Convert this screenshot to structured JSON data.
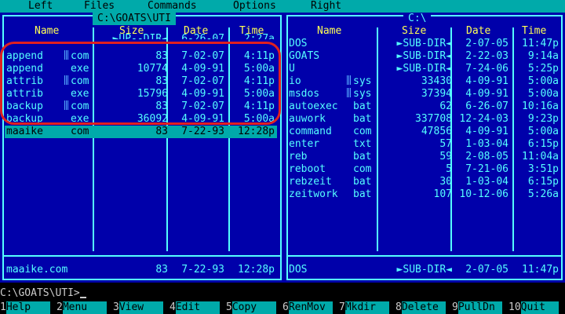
{
  "menu": [
    "Left",
    "Files",
    "Commands",
    "Options",
    "Right"
  ],
  "columns": {
    "name": "Name",
    "size": "Size",
    "date": "Date",
    "time": "Time"
  },
  "left_panel": {
    "title": "C:\\GOATS\\UTI",
    "top_partial": {
      "size": "►UP--DIR◄",
      "date": "6-26-07",
      "time": "2:27a"
    },
    "files": [
      {
        "name": "append",
        "ext": "com",
        "size": "83",
        "date": "7-02-07",
        "time": "4:11p",
        "marked": true
      },
      {
        "name": "append",
        "ext": "exe",
        "size": "10774",
        "date": "4-09-91",
        "time": "5:00a",
        "marked": false
      },
      {
        "name": "attrib",
        "ext": "com",
        "size": "83",
        "date": "7-02-07",
        "time": "4:11p",
        "marked": true
      },
      {
        "name": "attrib",
        "ext": "exe",
        "size": "15796",
        "date": "4-09-91",
        "time": "5:00a",
        "marked": false
      },
      {
        "name": "backup",
        "ext": "com",
        "size": "83",
        "date": "7-02-07",
        "time": "4:11p",
        "marked": true
      },
      {
        "name": "backup",
        "ext": "exe",
        "size": "36092",
        "date": "4-09-91",
        "time": "5:00a",
        "marked": false
      }
    ],
    "cursor_row": {
      "name": "maaike",
      "ext": "com",
      "size": "83",
      "date": "7-22-93",
      "time": "12:28p"
    },
    "status": {
      "name": "maaike.com",
      "size": "83",
      "date": "7-22-93",
      "time": "12:28p"
    }
  },
  "right_panel": {
    "title": "C:\\",
    "files": [
      {
        "name": "DOS",
        "ext": "",
        "size": "►SUB-DIR◄",
        "date": "2-07-05",
        "time": "11:47p",
        "marked": false
      },
      {
        "name": "GOATS",
        "ext": "",
        "size": "►SUB-DIR◄",
        "date": "2-22-03",
        "time": "9:14a",
        "marked": false
      },
      {
        "name": "U",
        "ext": "",
        "size": "►SUB-DIR◄",
        "date": "7-24-06",
        "time": "5:25p",
        "marked": false
      },
      {
        "name": "io",
        "ext": "sys",
        "size": "33430",
        "date": "4-09-91",
        "time": "5:00a",
        "marked": true
      },
      {
        "name": "msdos",
        "ext": "sys",
        "size": "37394",
        "date": "4-09-91",
        "time": "5:00a",
        "marked": true
      },
      {
        "name": "autoexec",
        "ext": "bat",
        "size": "62",
        "date": "6-26-07",
        "time": "10:16a",
        "marked": false
      },
      {
        "name": "auwork",
        "ext": "bat",
        "size": "337708",
        "date": "12-24-03",
        "time": "9:23p",
        "marked": false
      },
      {
        "name": "command",
        "ext": "com",
        "size": "47856",
        "date": "4-09-91",
        "time": "5:00a",
        "marked": false
      },
      {
        "name": "enter",
        "ext": "txt",
        "size": "57",
        "date": "1-03-04",
        "time": "6:15p",
        "marked": false
      },
      {
        "name": "reb",
        "ext": "bat",
        "size": "59",
        "date": "2-08-05",
        "time": "11:04a",
        "marked": false
      },
      {
        "name": "reboot",
        "ext": "com",
        "size": "5",
        "date": "7-21-06",
        "time": "3:51p",
        "marked": false
      },
      {
        "name": "rebzeit",
        "ext": "bat",
        "size": "30",
        "date": "1-03-04",
        "time": "6:15p",
        "marked": false
      },
      {
        "name": "zeitwork",
        "ext": "bat",
        "size": "107",
        "date": "10-12-06",
        "time": "5:26a",
        "marked": false
      }
    ],
    "status": {
      "name": "DOS",
      "size": "►SUB-DIR◄",
      "date": "2-07-05",
      "time": "11:47p"
    }
  },
  "command_line": "C:\\GOATS\\UTI>",
  "function_keys": [
    {
      "num": "1",
      "label": "Help"
    },
    {
      "num": "2",
      "label": "Menu"
    },
    {
      "num": "3",
      "label": "View"
    },
    {
      "num": "4",
      "label": "Edit"
    },
    {
      "num": "5",
      "label": "Copy"
    },
    {
      "num": "6",
      "label": "RenMov"
    },
    {
      "num": "7",
      "label": "Mkdir"
    },
    {
      "num": "8",
      "label": "Delete"
    },
    {
      "num": "9",
      "label": "PullDn"
    },
    {
      "num": "10",
      "label": "Quit"
    }
  ],
  "colors": {
    "panel_bg": "#0000aa",
    "text": "#55ffff",
    "header": "#ffff55",
    "highlight": "#00aaaa",
    "annotation": "#e02020"
  }
}
